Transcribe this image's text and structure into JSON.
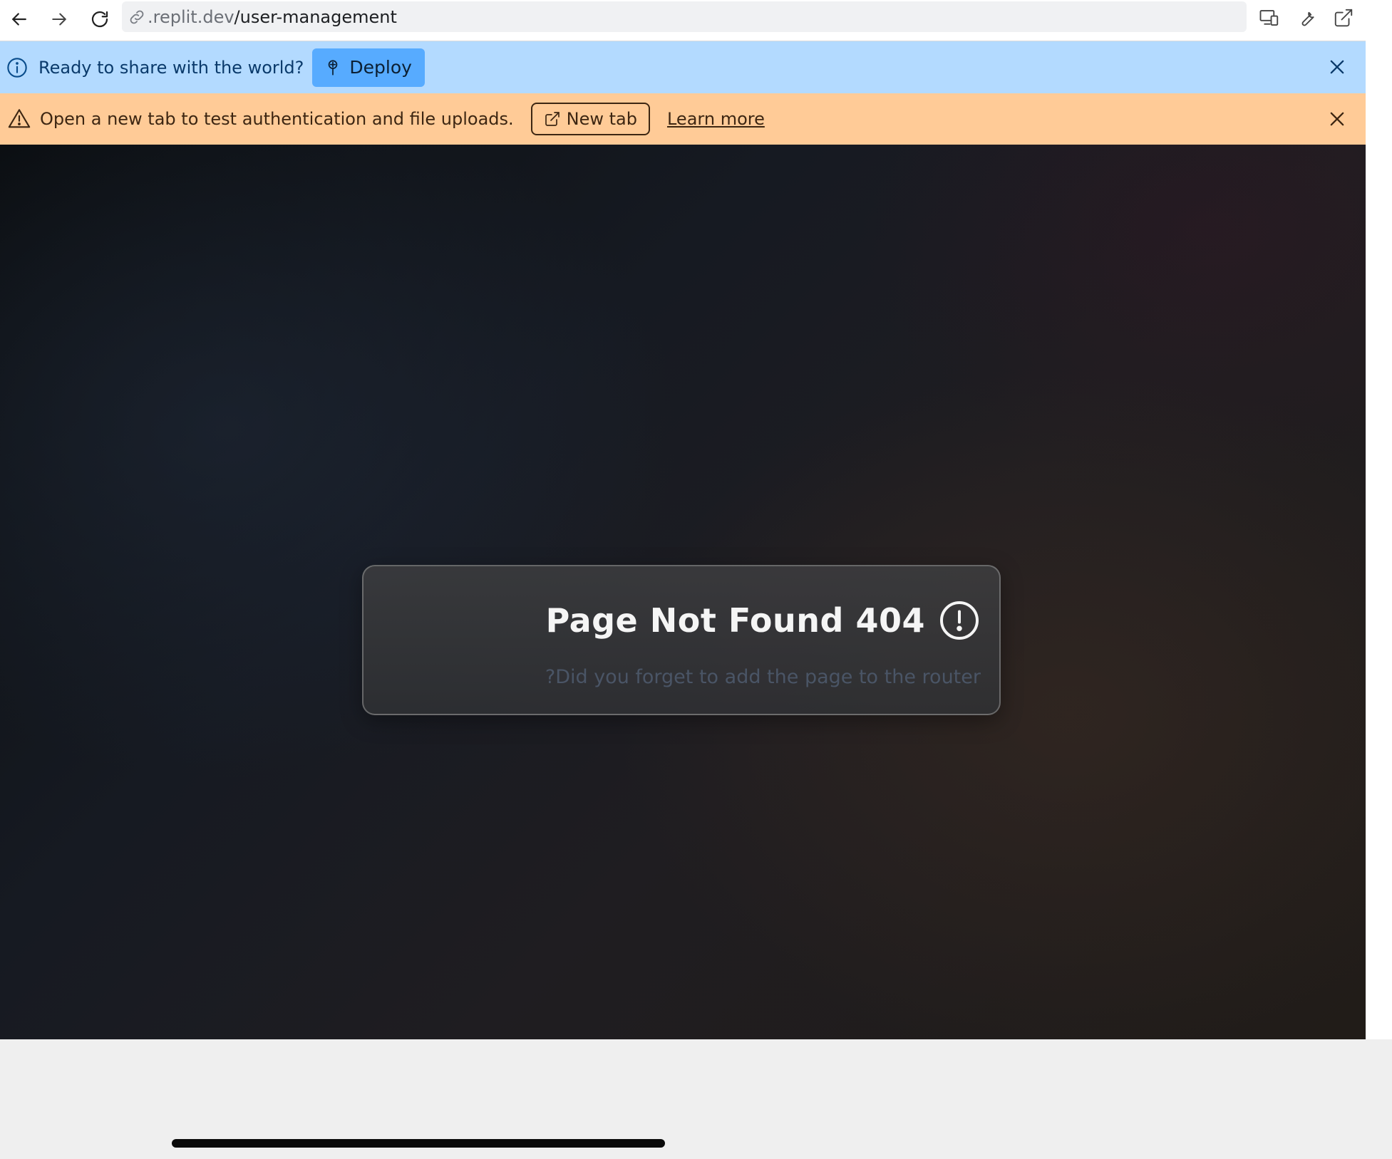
{
  "browser": {
    "url_host": ".replit.dev",
    "url_path": "/user-management",
    "icons": {
      "back": "arrow-left-icon",
      "forward": "arrow-right-icon",
      "reload": "reload-icon",
      "link": "link-icon",
      "devices": "devices-icon",
      "devtools": "wrench-icon",
      "open_external": "external-link-icon"
    }
  },
  "info_banner": {
    "message": "Ready to share with the world?",
    "deploy_label": "Deploy",
    "bg_color": "#b3daff",
    "button_color": "#57abff"
  },
  "warning_banner": {
    "message": "Open a new tab to test authentication and file uploads.",
    "new_tab_label": "New tab",
    "learn_more_label": "Learn more",
    "bg_color": "#ffcb97"
  },
  "error_card": {
    "title": "Page Not Found 404",
    "subtitle": "?Did you forget to add the page to the router",
    "icon": "alert-circle-icon"
  }
}
